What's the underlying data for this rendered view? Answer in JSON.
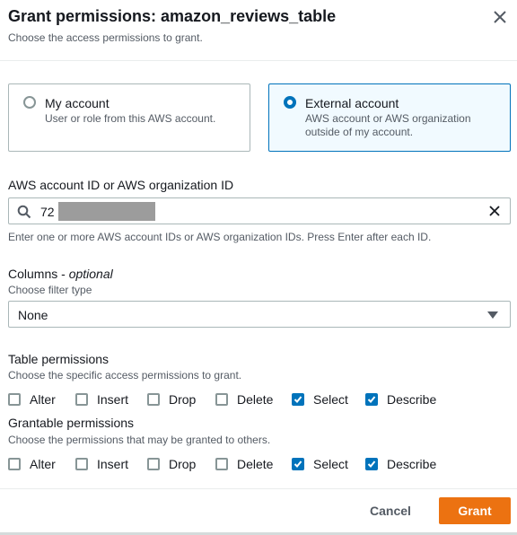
{
  "header": {
    "title": "Grant permissions: amazon_reviews_table",
    "subtitle": "Choose the access permissions to grant."
  },
  "account_type": {
    "options": [
      {
        "label": "My account",
        "description": "User or role from this AWS account.",
        "selected": false
      },
      {
        "label": "External account",
        "description": "AWS account or AWS organization outside of my account.",
        "selected": true
      }
    ]
  },
  "account_id": {
    "label": "AWS account ID or AWS organization ID",
    "value": "72",
    "hint": "Enter one or more AWS account IDs or AWS organization IDs. Press Enter after each ID."
  },
  "columns": {
    "label": "Columns",
    "label_suffix": " - ",
    "optional": "optional",
    "sublabel": "Choose filter type",
    "selected": "None"
  },
  "table_permissions": {
    "label": "Table permissions",
    "sublabel": "Choose the specific access permissions to grant.",
    "items": [
      {
        "label": "Alter",
        "checked": false
      },
      {
        "label": "Insert",
        "checked": false
      },
      {
        "label": "Drop",
        "checked": false
      },
      {
        "label": "Delete",
        "checked": false
      },
      {
        "label": "Select",
        "checked": true
      },
      {
        "label": "Describe",
        "checked": true
      }
    ]
  },
  "grantable_permissions": {
    "label": "Grantable permissions",
    "sublabel": "Choose the permissions that may be granted to others.",
    "items": [
      {
        "label": "Alter",
        "checked": false
      },
      {
        "label": "Insert",
        "checked": false
      },
      {
        "label": "Drop",
        "checked": false
      },
      {
        "label": "Delete",
        "checked": false
      },
      {
        "label": "Select",
        "checked": true
      },
      {
        "label": "Describe",
        "checked": true
      }
    ]
  },
  "footer": {
    "cancel_label": "Cancel",
    "grant_label": "Grant"
  },
  "colors": {
    "accent": "#0073bb",
    "primary_button": "#ec7211"
  },
  "icons": [
    "close-icon",
    "search-icon",
    "clear-icon",
    "chevron-down-icon",
    "checkmark-icon"
  ]
}
